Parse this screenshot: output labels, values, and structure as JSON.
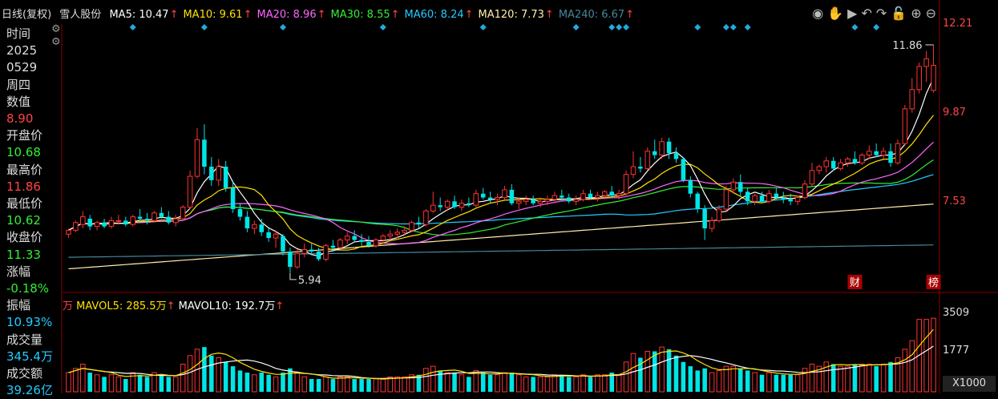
{
  "header": {
    "period": "日线(复权)",
    "stock_name": "雪人股份",
    "ma": [
      {
        "label": "MA5: 10.47",
        "arrow": "↑",
        "color": "#ffffff"
      },
      {
        "label": "MA10: 9.61",
        "arrow": "↑",
        "color": "#ffe100"
      },
      {
        "label": "MA20: 8.96",
        "arrow": "↑",
        "color": "#ff66ff"
      },
      {
        "label": "MA30: 8.55",
        "arrow": "↑",
        "color": "#33ee33"
      },
      {
        "label": "MA60: 8.24",
        "arrow": "↑",
        "color": "#22ccff"
      },
      {
        "label": "MA120: 7.73",
        "arrow": "↑",
        "color": "#ffeeaa"
      },
      {
        "label": "MA240: 6.67",
        "arrow": "↑",
        "color": "#448899"
      }
    ]
  },
  "toolbar": [
    "eye-icon",
    "hand-icon",
    "play-icon",
    "undo-icon",
    "redo-icon",
    "lock-icon",
    "zoom-in-icon",
    "zoom-out-icon"
  ],
  "sidebar": {
    "time_label": "时间",
    "year": "2025",
    "date": "0529",
    "weekday": "周四",
    "value_label": "数值",
    "value": "8.90",
    "open_label": "开盘价",
    "open": "10.68",
    "high_label": "最高价",
    "high": "11.86",
    "low_label": "最低价",
    "low": "10.62",
    "close_label": "收盘价",
    "close": "11.33",
    "change_label": "涨幅",
    "change": "-0.18%",
    "amplitude_label": "振幅",
    "amplitude": "10.93%",
    "volume_label": "成交量",
    "volume": "345.4万",
    "amount_label": "成交额",
    "amount": "39.26亿"
  },
  "price_axis": {
    "top": "12.21",
    "mid": "9.87",
    "low": "7.53"
  },
  "annotations": {
    "high_label": "11.86",
    "low_label": "5.94",
    "cai": "财",
    "bang": "榜"
  },
  "volume_legend": {
    "unit": "万",
    "mavol5": "MAVOL5: 285.5万",
    "mavol10": "MAVOL10: 192.7万",
    "arrow": "↑"
  },
  "volume_axis": {
    "top": "3509",
    "mid": "1777",
    "unit": "X1000"
  },
  "colors": {
    "up": "#ff3333",
    "down": "#00e5e5",
    "bg": "#000000"
  },
  "chart_data": {
    "type": "candlestick",
    "ylim": [
      5.5,
      12.4
    ],
    "volume_ylim": [
      0,
      3800
    ],
    "candles": [
      [
        6.95,
        7.1,
        6.85,
        7.05,
        900
      ],
      [
        7.05,
        7.3,
        7.0,
        7.25,
        1100
      ],
      [
        7.2,
        7.55,
        7.1,
        7.4,
        1300
      ],
      [
        7.35,
        7.45,
        7.05,
        7.15,
        900
      ],
      [
        7.15,
        7.3,
        7.05,
        7.25,
        800
      ],
      [
        7.25,
        7.35,
        7.1,
        7.15,
        700
      ],
      [
        7.15,
        7.4,
        7.1,
        7.3,
        800
      ],
      [
        7.3,
        7.45,
        7.2,
        7.3,
        700
      ],
      [
        7.3,
        7.4,
        7.15,
        7.2,
        600
      ],
      [
        7.2,
        7.45,
        7.15,
        7.4,
        900
      ],
      [
        7.4,
        7.6,
        7.3,
        7.35,
        800
      ],
      [
        7.35,
        7.5,
        7.2,
        7.3,
        700
      ],
      [
        7.3,
        7.55,
        7.25,
        7.5,
        900
      ],
      [
        7.5,
        7.65,
        7.35,
        7.4,
        800
      ],
      [
        7.4,
        7.55,
        7.2,
        7.25,
        700
      ],
      [
        7.25,
        7.45,
        7.15,
        7.35,
        700
      ],
      [
        7.35,
        7.7,
        7.3,
        7.65,
        1300
      ],
      [
        7.65,
        8.6,
        7.6,
        8.45,
        1700
      ],
      [
        8.45,
        9.7,
        8.4,
        9.4,
        2000
      ],
      [
        9.4,
        9.8,
        8.5,
        8.7,
        2100
      ],
      [
        8.7,
        8.95,
        8.2,
        8.35,
        1700
      ],
      [
        8.35,
        8.9,
        8.2,
        8.7,
        1600
      ],
      [
        8.7,
        8.85,
        8.05,
        8.15,
        1400
      ],
      [
        8.15,
        8.3,
        7.5,
        7.6,
        1200
      ],
      [
        7.6,
        7.75,
        7.3,
        7.4,
        1000
      ],
      [
        7.4,
        7.55,
        7.0,
        7.1,
        900
      ],
      [
        7.1,
        7.3,
        6.95,
        7.2,
        800
      ],
      [
        7.2,
        7.35,
        6.9,
        7.0,
        900
      ],
      [
        7.0,
        7.1,
        6.75,
        6.85,
        800
      ],
      [
        6.85,
        7.05,
        6.6,
        6.95,
        700
      ],
      [
        6.9,
        6.95,
        6.4,
        6.5,
        900
      ],
      [
        6.5,
        6.6,
        5.94,
        6.1,
        1100
      ],
      [
        6.1,
        6.55,
        6.05,
        6.45,
        900
      ],
      [
        6.45,
        6.7,
        6.35,
        6.55,
        700
      ],
      [
        6.55,
        6.7,
        6.4,
        6.5,
        600
      ],
      [
        6.5,
        6.6,
        6.25,
        6.3,
        600
      ],
      [
        6.3,
        6.7,
        6.25,
        6.65,
        700
      ],
      [
        6.65,
        6.8,
        6.5,
        6.6,
        600
      ],
      [
        6.6,
        6.85,
        6.55,
        6.8,
        700
      ],
      [
        6.8,
        7.0,
        6.7,
        6.9,
        700
      ],
      [
        6.9,
        7.05,
        6.75,
        6.8,
        600
      ],
      [
        6.8,
        6.95,
        6.65,
        6.75,
        600
      ],
      [
        6.75,
        6.9,
        6.6,
        6.65,
        600
      ],
      [
        6.65,
        6.85,
        6.6,
        6.8,
        600
      ],
      [
        6.8,
        6.95,
        6.7,
        6.9,
        600
      ],
      [
        6.9,
        7.05,
        6.8,
        6.95,
        700
      ],
      [
        6.95,
        7.1,
        6.85,
        7.0,
        700
      ],
      [
        7.0,
        7.15,
        6.9,
        7.05,
        700
      ],
      [
        7.05,
        7.3,
        7.0,
        7.25,
        800
      ],
      [
        7.25,
        7.4,
        7.1,
        7.2,
        800
      ],
      [
        7.2,
        7.6,
        7.15,
        7.55,
        1100
      ],
      [
        7.55,
        8.05,
        7.5,
        7.7,
        1200
      ],
      [
        7.7,
        7.9,
        7.55,
        7.65,
        1000
      ],
      [
        7.65,
        7.85,
        7.55,
        7.8,
        900
      ],
      [
        7.8,
        7.95,
        7.6,
        7.65,
        900
      ],
      [
        7.65,
        7.85,
        7.55,
        7.75,
        800
      ],
      [
        7.75,
        7.9,
        7.65,
        7.7,
        700
      ],
      [
        7.7,
        8.1,
        7.65,
        8.0,
        1000
      ],
      [
        8.0,
        8.15,
        7.85,
        7.9,
        900
      ],
      [
        7.9,
        8.05,
        7.75,
        7.85,
        800
      ],
      [
        7.85,
        8.0,
        7.7,
        7.9,
        800
      ],
      [
        7.9,
        8.2,
        7.85,
        8.1,
        900
      ],
      [
        8.1,
        8.25,
        7.7,
        7.75,
        900
      ],
      [
        7.75,
        7.9,
        7.6,
        7.8,
        800
      ],
      [
        7.8,
        7.95,
        7.7,
        7.85,
        700
      ],
      [
        7.85,
        7.95,
        7.7,
        7.75,
        700
      ],
      [
        7.75,
        7.9,
        7.65,
        7.8,
        700
      ],
      [
        7.8,
        7.95,
        7.7,
        7.85,
        700
      ],
      [
        7.85,
        8.05,
        7.75,
        7.95,
        800
      ],
      [
        7.95,
        8.1,
        7.8,
        7.9,
        800
      ],
      [
        7.9,
        8.0,
        7.75,
        7.8,
        700
      ],
      [
        7.8,
        7.95,
        7.7,
        7.85,
        700
      ],
      [
        7.85,
        8.1,
        7.8,
        8.0,
        800
      ],
      [
        8.0,
        8.1,
        7.85,
        7.9,
        700
      ],
      [
        7.9,
        8.05,
        7.8,
        7.95,
        800
      ],
      [
        7.95,
        8.1,
        7.85,
        8.05,
        800
      ],
      [
        8.05,
        8.2,
        7.9,
        7.95,
        900
      ],
      [
        7.95,
        8.1,
        7.85,
        8.0,
        800
      ],
      [
        8.0,
        8.6,
        7.95,
        8.5,
        1400
      ],
      [
        8.5,
        9.1,
        8.4,
        8.7,
        1800
      ],
      [
        8.7,
        8.95,
        8.55,
        8.65,
        1600
      ],
      [
        8.65,
        9.2,
        8.6,
        9.1,
        1900
      ],
      [
        9.1,
        9.4,
        8.9,
        9.0,
        1900
      ],
      [
        9.0,
        9.45,
        8.9,
        9.35,
        2100
      ],
      [
        9.35,
        9.45,
        8.9,
        9.05,
        2000
      ],
      [
        9.05,
        9.2,
        8.8,
        8.9,
        1700
      ],
      [
        8.9,
        8.95,
        8.3,
        8.35,
        1400
      ],
      [
        8.35,
        8.45,
        7.9,
        8.0,
        1200
      ],
      [
        8.0,
        8.05,
        7.5,
        7.6,
        1000
      ],
      [
        7.6,
        7.7,
        6.8,
        7.1,
        1100
      ],
      [
        7.1,
        7.4,
        7.0,
        7.3,
        900
      ],
      [
        7.3,
        7.7,
        7.25,
        7.6,
        1000
      ],
      [
        7.6,
        8.2,
        7.55,
        8.1,
        1200
      ],
      [
        8.1,
        8.4,
        8.0,
        8.3,
        1200
      ],
      [
        8.3,
        8.5,
        7.95,
        8.05,
        1100
      ],
      [
        8.05,
        8.15,
        7.7,
        7.8,
        1000
      ],
      [
        7.8,
        8.0,
        7.7,
        7.95,
        900
      ],
      [
        7.95,
        8.05,
        7.75,
        7.8,
        800
      ],
      [
        7.8,
        8.1,
        7.75,
        8.0,
        900
      ],
      [
        8.0,
        8.15,
        7.85,
        7.9,
        800
      ],
      [
        7.9,
        8.05,
        7.75,
        7.85,
        800
      ],
      [
        7.85,
        8.0,
        7.7,
        7.8,
        800
      ],
      [
        7.8,
        7.95,
        7.7,
        7.9,
        800
      ],
      [
        7.9,
        8.35,
        7.85,
        8.25,
        1100
      ],
      [
        8.25,
        8.8,
        8.2,
        8.6,
        1300
      ],
      [
        8.6,
        8.75,
        8.5,
        8.7,
        1200
      ],
      [
        8.7,
        8.95,
        8.55,
        8.85,
        1400
      ],
      [
        8.85,
        8.95,
        8.6,
        8.65,
        1300
      ],
      [
        8.65,
        8.9,
        8.6,
        8.8,
        1200
      ],
      [
        8.8,
        8.95,
        8.7,
        8.9,
        1200
      ],
      [
        8.9,
        9.1,
        8.75,
        8.8,
        1300
      ],
      [
        8.8,
        9.05,
        8.75,
        9.0,
        1300
      ],
      [
        9.0,
        9.25,
        8.9,
        9.1,
        1300
      ],
      [
        9.1,
        9.3,
        8.95,
        9.0,
        1200
      ],
      [
        9.0,
        9.2,
        8.9,
        9.1,
        1300
      ],
      [
        9.1,
        9.3,
        8.7,
        8.8,
        1400
      ],
      [
        8.8,
        9.4,
        8.75,
        9.3,
        1600
      ],
      [
        9.3,
        10.3,
        9.25,
        10.2,
        2000
      ],
      [
        10.2,
        11.0,
        10.1,
        10.7,
        2400
      ],
      [
        10.7,
        11.4,
        10.6,
        11.3,
        3400
      ],
      [
        11.3,
        11.7,
        10.9,
        11.5,
        3400
      ],
      [
        10.68,
        11.86,
        10.62,
        11.33,
        3454
      ]
    ]
  }
}
